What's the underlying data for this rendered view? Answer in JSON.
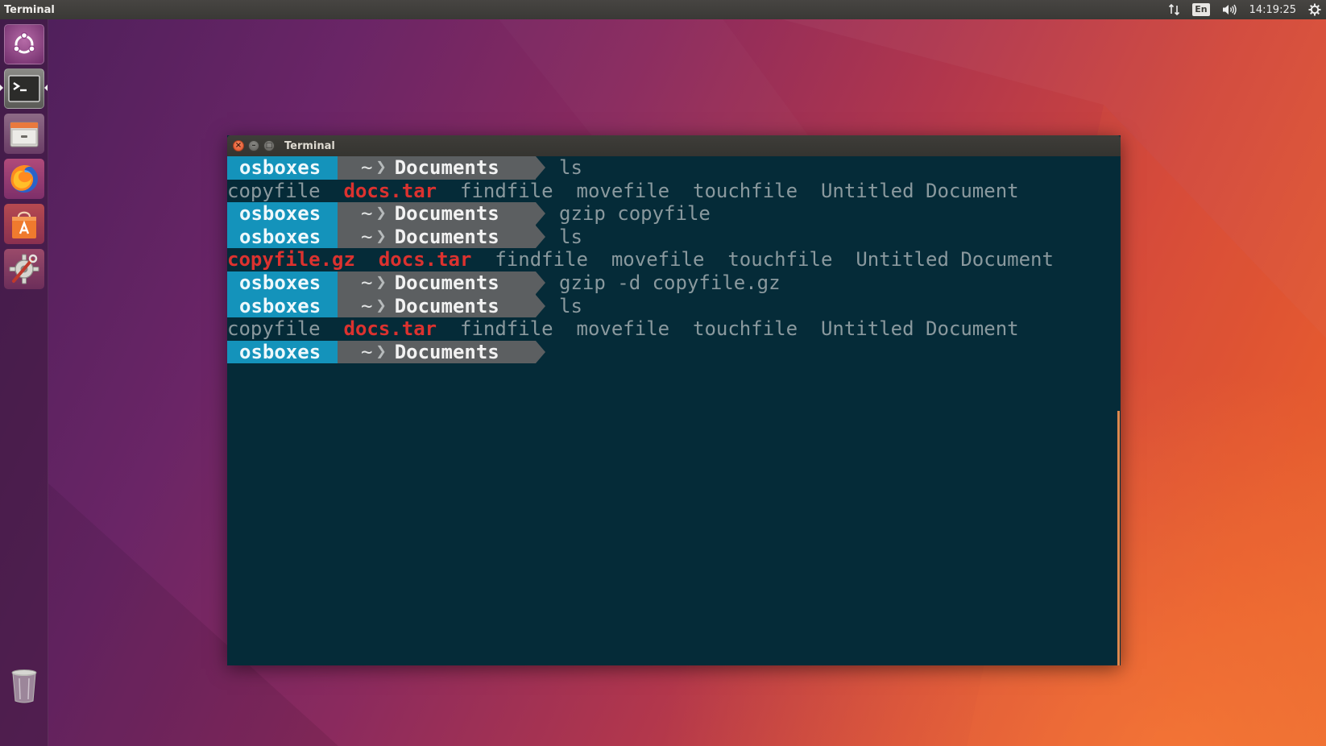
{
  "top_panel": {
    "app_title": "Terminal",
    "indicators": {
      "network_icon": "network-updown-icon",
      "keyboard_layout": "En",
      "volume_icon": "volume-icon",
      "clock": "14:19:25",
      "session_icon": "gear-icon"
    }
  },
  "launcher": {
    "items": [
      {
        "name": "dash-home",
        "icon": "ubuntu-logo-icon"
      },
      {
        "name": "terminal",
        "icon": "terminal-icon",
        "active": true
      },
      {
        "name": "files",
        "icon": "file-cabinet-icon"
      },
      {
        "name": "firefox",
        "icon": "firefox-icon"
      },
      {
        "name": "software-center",
        "icon": "shopping-bag-icon"
      },
      {
        "name": "system-settings",
        "icon": "settings-wrench-icon"
      },
      {
        "name": "trash",
        "icon": "trash-icon"
      }
    ]
  },
  "window": {
    "title": "Terminal",
    "buttons": {
      "close": "×",
      "minimize": "–",
      "maximize": "□"
    }
  },
  "prompt": {
    "user": "osboxes",
    "home": "~",
    "separator": "❯",
    "dir": "Documents"
  },
  "lines": [
    {
      "type": "prompt",
      "command": "ls"
    },
    {
      "type": "ls",
      "entries": [
        {
          "text": "copyfile",
          "kind": "plain"
        },
        {
          "text": "docs.tar",
          "kind": "archive"
        },
        {
          "text": "findfile",
          "kind": "plain"
        },
        {
          "text": "movefile",
          "kind": "plain"
        },
        {
          "text": "touchfile",
          "kind": "plain"
        },
        {
          "text": "Untitled Document",
          "kind": "plain"
        }
      ]
    },
    {
      "type": "prompt",
      "command": "gzip copyfile"
    },
    {
      "type": "prompt",
      "command": "ls"
    },
    {
      "type": "ls",
      "entries": [
        {
          "text": "copyfile.gz",
          "kind": "archive"
        },
        {
          "text": "docs.tar",
          "kind": "archive"
        },
        {
          "text": "findfile",
          "kind": "plain"
        },
        {
          "text": "movefile",
          "kind": "plain"
        },
        {
          "text": "touchfile",
          "kind": "plain"
        },
        {
          "text": "Untitled Document",
          "kind": "plain"
        }
      ]
    },
    {
      "type": "prompt",
      "command": "gzip -d copyfile.gz"
    },
    {
      "type": "prompt",
      "command": "ls"
    },
    {
      "type": "ls",
      "entries": [
        {
          "text": "copyfile",
          "kind": "plain"
        },
        {
          "text": "docs.tar",
          "kind": "archive"
        },
        {
          "text": "findfile",
          "kind": "plain"
        },
        {
          "text": "movefile",
          "kind": "plain"
        },
        {
          "text": "touchfile",
          "kind": "plain"
        },
        {
          "text": "Untitled Document",
          "kind": "plain"
        }
      ]
    },
    {
      "type": "prompt",
      "command": ""
    }
  ],
  "colors": {
    "terminal_bg": "#052b38",
    "prompt_user_bg": "#1493bb",
    "prompt_path_bg": "#5c5f61",
    "archive_text": "#dc322f",
    "plain_text": "#8a999e",
    "accent_orange": "#e0884d"
  }
}
